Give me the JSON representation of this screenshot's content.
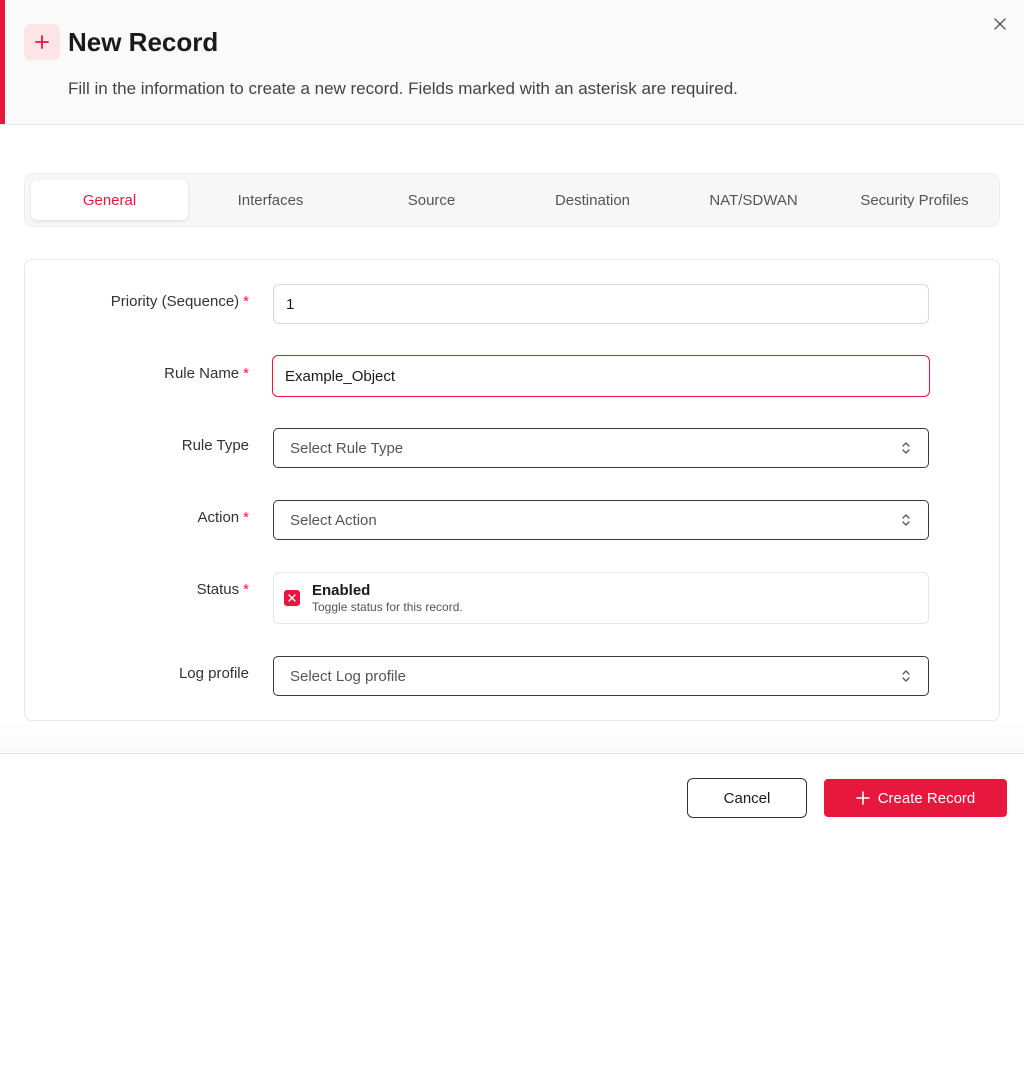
{
  "header": {
    "title": "New Record",
    "subtitle": "Fill in the information to create a new record. Fields marked with an asterisk are required.",
    "accent_color": "#e8173d",
    "icon": "plus-icon",
    "close_icon": "close-icon"
  },
  "tabs": [
    {
      "label": "General",
      "active": true
    },
    {
      "label": "Interfaces",
      "active": false
    },
    {
      "label": "Source",
      "active": false
    },
    {
      "label": "Destination",
      "active": false
    },
    {
      "label": "NAT/SDWAN",
      "active": false
    },
    {
      "label": "Security Profiles",
      "active": false
    }
  ],
  "form": {
    "priority": {
      "label": "Priority (Sequence)",
      "required": "*",
      "value": "1"
    },
    "rule_name": {
      "label": "Rule Name",
      "required": "*",
      "value": "Example_Object"
    },
    "rule_type": {
      "label": "Rule Type",
      "placeholder": "Select Rule Type"
    },
    "action": {
      "label": "Action",
      "required": "*",
      "placeholder": "Select Action"
    },
    "status": {
      "label": "Status",
      "required": "*",
      "title": "Enabled",
      "description": "Toggle status for this record."
    },
    "log_profile": {
      "label": "Log profile",
      "placeholder": "Select Log profile"
    }
  },
  "footer": {
    "cancel_label": "Cancel",
    "create_label": "Create Record"
  }
}
